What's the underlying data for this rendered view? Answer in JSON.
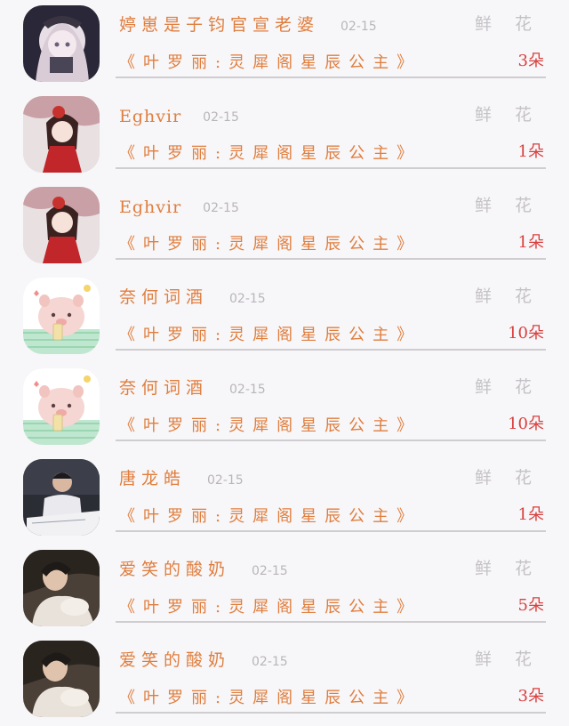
{
  "flower_label": "鲜 花",
  "rows": [
    {
      "name": "婷崽是子钧官宣老婆",
      "date": "02-15",
      "gift": "《叶罗丽:灵犀阁星辰公主》",
      "count": "3朵"
    },
    {
      "name": "Eghvir",
      "date": "02-15",
      "gift": "《叶罗丽:灵犀阁星辰公主》",
      "count": "1朵"
    },
    {
      "name": "Eghvir",
      "date": "02-15",
      "gift": "《叶罗丽:灵犀阁星辰公主》",
      "count": "1朵"
    },
    {
      "name": "奈何词酒",
      "date": "02-15",
      "gift": "《叶罗丽:灵犀阁星辰公主》",
      "count": "10朵"
    },
    {
      "name": "奈何词酒",
      "date": "02-15",
      "gift": "《叶罗丽:灵犀阁星辰公主》",
      "count": "10朵"
    },
    {
      "name": "唐龙皓",
      "date": "02-15",
      "gift": "《叶罗丽:灵犀阁星辰公主》",
      "count": "1朵"
    },
    {
      "name": "爱笑的酸奶",
      "date": "02-15",
      "gift": "《叶罗丽:灵犀阁星辰公主》",
      "count": "5朵"
    },
    {
      "name": "爱笑的酸奶",
      "date": "02-15",
      "gift": "《叶罗丽:灵犀阁星辰公主》",
      "count": "3朵"
    }
  ],
  "avatar_icons": [
    "anime-girl-avatar",
    "anime-girl-red-avatar",
    "anime-girl-red-avatar",
    "pig-avatar",
    "pig-avatar",
    "man-photo-avatar",
    "couple-photo-avatar",
    "couple-photo-avatar"
  ]
}
